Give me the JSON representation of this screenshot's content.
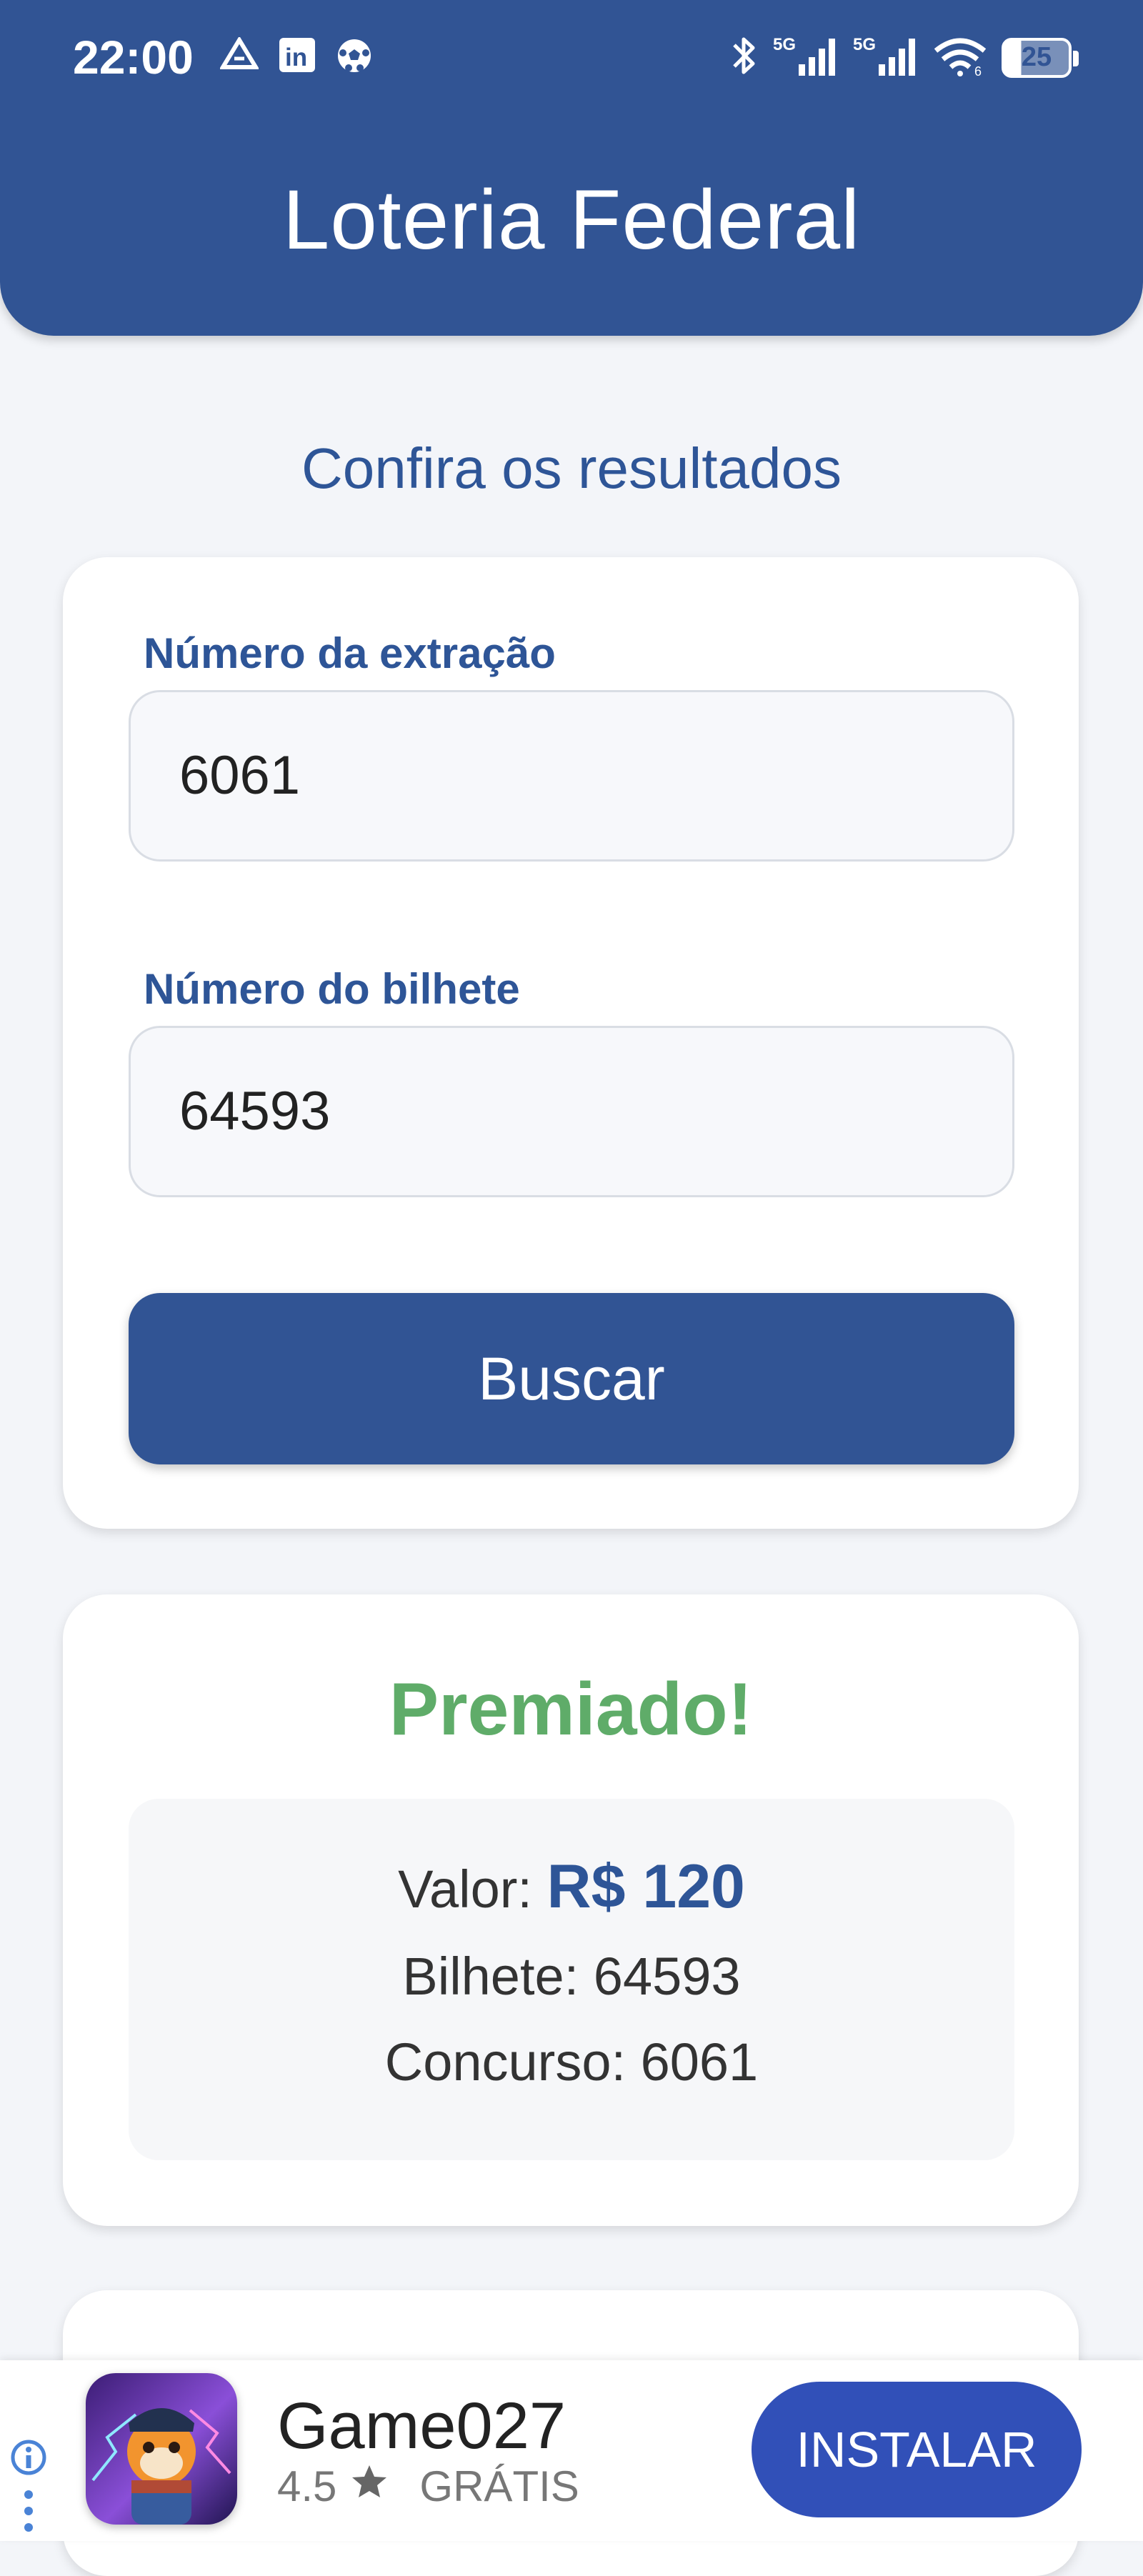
{
  "status_bar": {
    "time": "22:00",
    "battery_level": "25",
    "left_icons": [
      "triangle-icon",
      "linkedin-icon",
      "soccer-ball-icon"
    ],
    "right_icons": [
      "bluetooth-icon",
      "5g-signal-icon",
      "5g-signal-icon",
      "wifi-icon",
      "battery-icon"
    ]
  },
  "header": {
    "title": "Loteria Federal"
  },
  "main": {
    "section_title": "Confira os resultados",
    "form": {
      "draw_label": "Número da extração",
      "draw_value": "6061",
      "ticket_label": "Número do bilhete",
      "ticket_value": "64593",
      "search_label": "Buscar"
    },
    "result": {
      "status": "Premiado!",
      "value_label": "Valor:",
      "value": "R$ 120",
      "ticket_line": "Bilhete: 64593",
      "contest_line": "Concurso: 6061"
    }
  },
  "ad": {
    "app_name": "Game027",
    "rating": "4.5",
    "price": "GRÁTIS",
    "install_label": "INSTALAR"
  },
  "colors": {
    "primary": "#315494",
    "success": "#5fac69",
    "install": "#3150b8"
  }
}
